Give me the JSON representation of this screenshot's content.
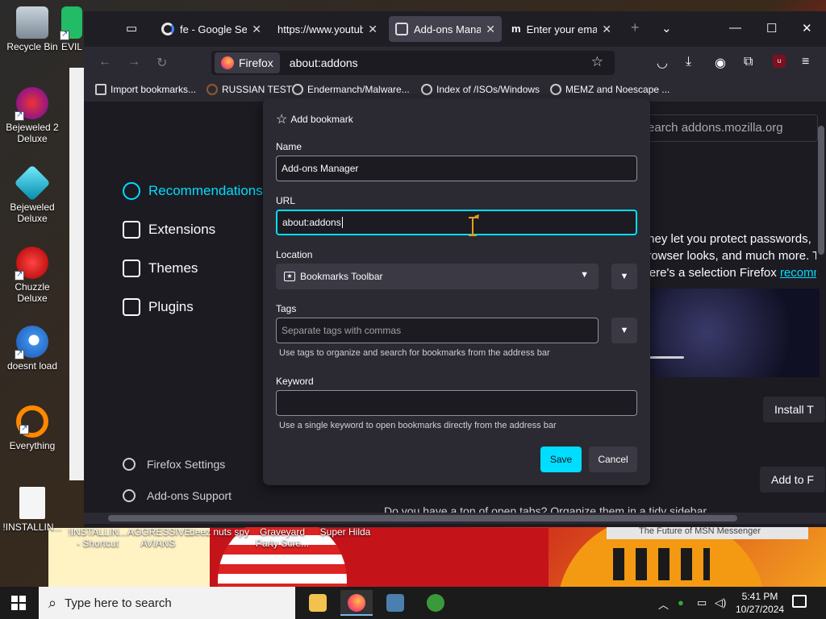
{
  "desktop": {
    "icons": [
      {
        "label": "Recycle Bin"
      },
      {
        "label": "EVIL"
      },
      {
        "label": "Bejeweled 2 Deluxe"
      },
      {
        "label": "Bejeweled Deluxe"
      },
      {
        "label": "Chuzzle Deluxe"
      },
      {
        "label": "doesnt load"
      },
      {
        "label": "Everything"
      },
      {
        "label": "!INSTALLIN..."
      }
    ],
    "bottom_labels": [
      "!INSTALLIN... - Shortcut",
      "AGGRESSIVE AVIANS",
      "deez nuts spy",
      "Graveyard Party Scre...",
      "Super Hilda"
    ],
    "msn_caption": "The Future of MSN Messenger"
  },
  "browser": {
    "tabs": [
      {
        "label": "fe - Google Search",
        "close": "✕"
      },
      {
        "label": "https://www.youtube.com",
        "close": "✕"
      },
      {
        "label": "Add-ons Manager",
        "close": "✕"
      },
      {
        "label": "Enter your email",
        "close": "✕"
      }
    ],
    "new_tab": "+",
    "identity_label": "Firefox",
    "url": "about:addons",
    "bookmarks": [
      "Import bookmarks...",
      "RUSSIAN TEST",
      "Endermanch/Malware...",
      "Index of /ISOs/Windows",
      "MEMZ and Noescape ..."
    ]
  },
  "addons": {
    "search_placeholder": "Search addons.mozilla.org",
    "categories": [
      "Recommendations",
      "Extensions",
      "Themes",
      "Plugins"
    ],
    "footer": [
      "Firefox Settings",
      "Add-ons Support"
    ],
    "intro_lines": [
      "They let you protect passwords,",
      "browser looks, and much more. Th",
      "Here's a selection Firefox "
    ],
    "intro_link": "recomme",
    "install_button": "Install T",
    "add_button": "Add to F",
    "bottom_text": "Do you have a ton of open tabs? Organize them in a tidy sidebar."
  },
  "bookmark_dialog": {
    "title": "Add bookmark",
    "name_label": "Name",
    "name_value": "Add-ons Manager",
    "url_label": "URL",
    "url_value": "about:addons",
    "location_label": "Location",
    "location_value": "Bookmarks Toolbar",
    "tags_label": "Tags",
    "tags_placeholder": "Separate tags with commas",
    "tags_hint": "Use tags to organize and search for bookmarks from the address bar",
    "keyword_label": "Keyword",
    "keyword_value": "",
    "keyword_hint": "Use a single keyword to open bookmarks directly from the address bar",
    "save": "Save",
    "cancel": "Cancel"
  },
  "taskbar": {
    "search_placeholder": "Type here to search",
    "time": "5:41 PM",
    "date": "10/27/2024"
  }
}
